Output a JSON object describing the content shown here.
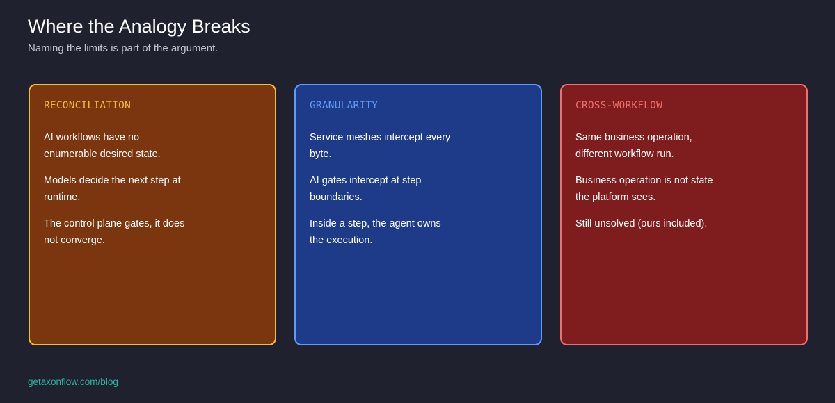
{
  "header": {
    "title": "Where the Analogy Breaks",
    "subtitle": "Naming the limits is part of the argument."
  },
  "cards": [
    {
      "heading": "RECONCILIATION",
      "paragraphs": [
        "AI workflows have no enumerable desired state.",
        "Models decide the next step at runtime.",
        "The control plane gates, it does not converge."
      ],
      "colors": {
        "background": "#7b3610",
        "border": "#f6bd2b",
        "heading": "#f6bd2b"
      }
    },
    {
      "heading": "GRANULARITY",
      "paragraphs": [
        "Service meshes intercept every byte.",
        "AI gates intercept at step boundaries.",
        "Inside a step, the agent owns the execution."
      ],
      "colors": {
        "background": "#1e3b8a",
        "border": "#5f9cf7",
        "heading": "#5f9cf7"
      }
    },
    {
      "heading": "CROSS-WORKFLOW",
      "paragraphs": [
        "Same business operation, different workflow run.",
        "Business operation is not state the platform sees.",
        "Still unsolved (ours included)."
      ],
      "colors": {
        "background": "#7f1c1d",
        "border": "#f06f6f",
        "heading": "#f06f6f"
      }
    }
  ],
  "footer": {
    "link": "getaxonflow.com/blog"
  },
  "colors": {
    "page_background": "#1f212e",
    "footer_link": "#2fb7a4"
  }
}
